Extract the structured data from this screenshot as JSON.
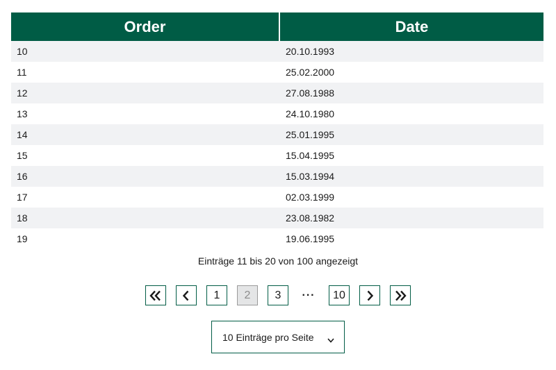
{
  "table": {
    "headers": [
      "Order",
      "Date"
    ],
    "rows": [
      [
        "10",
        "20.10.1993"
      ],
      [
        "11",
        "25.02.2000"
      ],
      [
        "12",
        "27.08.1988"
      ],
      [
        "13",
        "24.10.1980"
      ],
      [
        "14",
        "25.01.1995"
      ],
      [
        "15",
        "15.04.1995"
      ],
      [
        "16",
        "15.03.1994"
      ],
      [
        "17",
        "02.03.1999"
      ],
      [
        "18",
        "23.08.1982"
      ],
      [
        "19",
        "19.06.1995"
      ]
    ]
  },
  "info_text": "Einträge 11 bis 20 von 100 angezeigt",
  "pagination": {
    "first_icon": "double-chevron-left-icon",
    "prev_icon": "chevron-left-icon",
    "next_icon": "chevron-right-icon",
    "last_icon": "double-chevron-right-icon",
    "pages": [
      "1",
      "2",
      "3"
    ],
    "current_page": "2",
    "ellipsis": "···",
    "last_page": "10"
  },
  "per_page": {
    "label": "10 Einträge pro Seite",
    "icon": "chevron-down-icon"
  },
  "colors": {
    "header_bg": "#005c45",
    "accent_border": "#005c45",
    "stripe": "#f1f2f4",
    "active_page_bg": "#e4e5e6"
  }
}
